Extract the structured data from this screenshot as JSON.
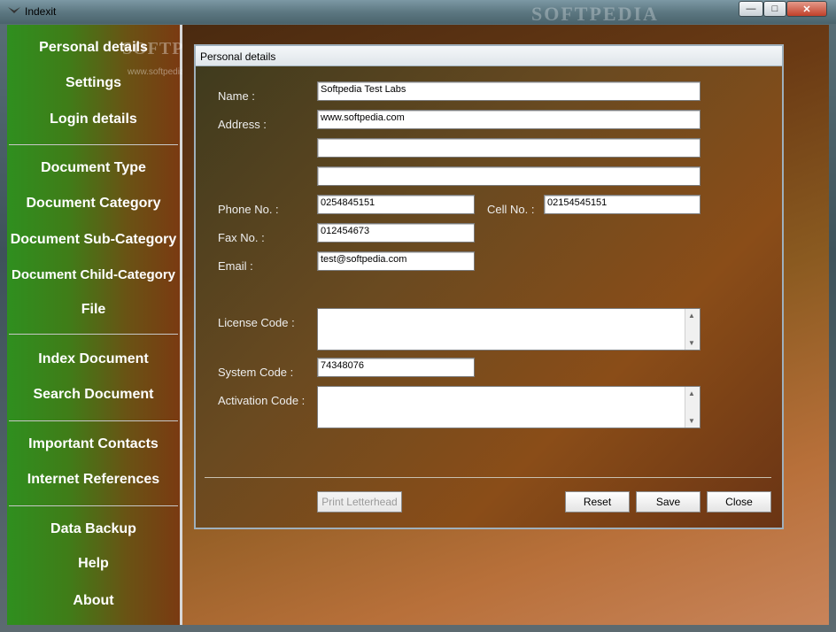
{
  "window": {
    "title": "Indexit",
    "watermark": "SOFTPEDIA"
  },
  "sidebar": {
    "watermark": "SOFTPEDIA",
    "watermark_url": "www.softpedia.com",
    "items": [
      {
        "label": "Personal details"
      },
      {
        "label": "Settings"
      },
      {
        "label": "Login details"
      },
      {
        "label": "Document Type"
      },
      {
        "label": "Document Category"
      },
      {
        "label": "Document Sub-Category"
      },
      {
        "label": "Document Child-Category"
      },
      {
        "label": "File"
      },
      {
        "label": "Index Document"
      },
      {
        "label": "Search Document"
      },
      {
        "label": "Important Contacts"
      },
      {
        "label": "Internet References"
      },
      {
        "label": "Data Backup"
      },
      {
        "label": "Help"
      },
      {
        "label": "About"
      }
    ]
  },
  "dialog": {
    "title": "Personal details",
    "labels": {
      "name": "Name :",
      "address": "Address :",
      "phone": "Phone No. :",
      "cell": "Cell No. :",
      "fax": "Fax No. :",
      "email": "Email :",
      "license": "License Code :",
      "system": "System Code :",
      "activation": "Activation Code :"
    },
    "values": {
      "name": "Softpedia Test Labs",
      "address1": "www.softpedia.com",
      "address2": "",
      "address3": "",
      "phone": "0254845151",
      "cell": "02154545151",
      "fax": "012454673",
      "email": "test@softpedia.com",
      "license": "",
      "system": "74348076",
      "activation": ""
    },
    "buttons": {
      "print": "Print Letterhead",
      "reset": "Reset",
      "save": "Save",
      "close": "Close"
    }
  }
}
